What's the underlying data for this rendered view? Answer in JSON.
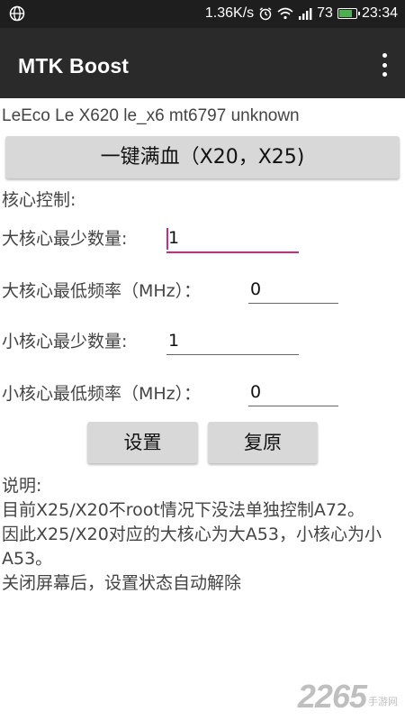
{
  "status_bar": {
    "network_speed": "1.36K/s",
    "signal_label": "all",
    "battery_level": "73",
    "time": "23:34",
    "battery_color": "#4caf50"
  },
  "app_bar": {
    "title": "MTK Boost",
    "background": "#2a2a2a"
  },
  "device_info": "LeEco Le X620 le_x6 mt6797 unknown",
  "boost_button": "一键满血（X20，X25)",
  "core_control_label": "核心控制:",
  "fields": [
    {
      "label": "大核心最少数量:",
      "value": "1"
    },
    {
      "label": "大核心最低频率（MHz）：",
      "value": "0"
    },
    {
      "label": "小核心最少数量:",
      "value": "1"
    },
    {
      "label": "小核心最低频率（MHz）：",
      "value": "0"
    }
  ],
  "buttons": {
    "set": "设置",
    "reset": "复原"
  },
  "notes": {
    "heading": "说明:",
    "lines": [
      "目前X25/X20不root情况下没法单独控制A72。",
      "因此X25/X20对应的大核心为大A53，小核心为小A53。",
      "关闭屏幕后，设置状态自动解除"
    ]
  },
  "watermark": {
    "number": "2265",
    "suffix": "手游网"
  },
  "accent_color": "#d8277a"
}
